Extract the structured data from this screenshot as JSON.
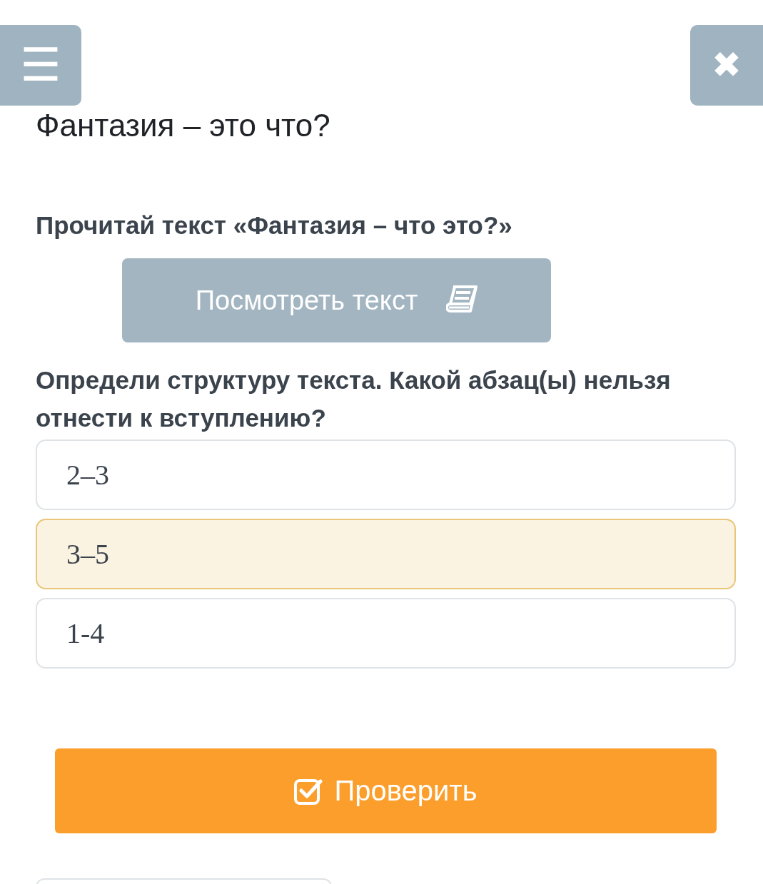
{
  "toolbar": {
    "menu_button": "☰",
    "close_button": "✖"
  },
  "title": "Фантазия – это что?",
  "instruction": "Прочитай текст «Фантазия – что это?»",
  "view_button": {
    "label": "Посмотреть текст"
  },
  "question": "Определи структуру текста. Какой абзац(ы) нельзя отнести к вступлению?",
  "options": [
    {
      "label": "2–3",
      "selected": false
    },
    {
      "label": "3–5",
      "selected": true
    },
    {
      "label": "1-4",
      "selected": false
    }
  ],
  "check_button": {
    "label": "Проверить"
  }
}
